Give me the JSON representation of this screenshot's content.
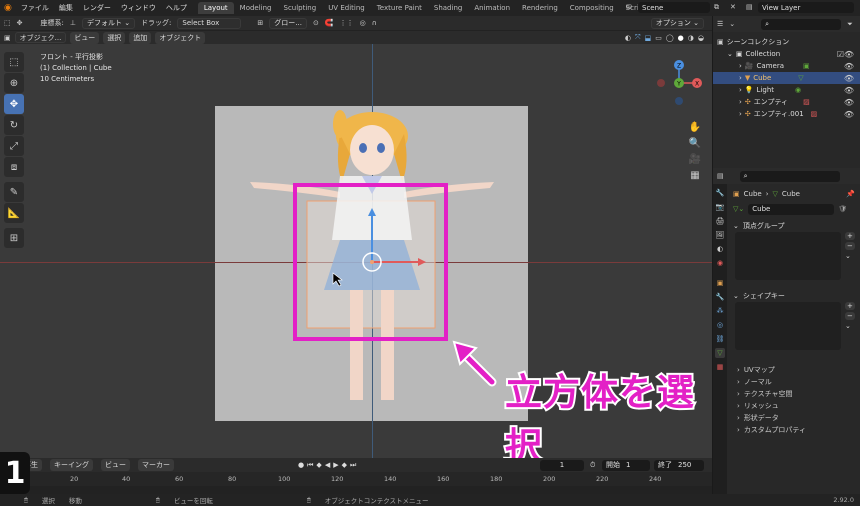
{
  "topbar": {
    "menus": [
      "ファイル",
      "編集",
      "レンダー",
      "ウィンドウ",
      "ヘルプ"
    ],
    "workspaces": [
      "Layout",
      "Modeling",
      "Sculpting",
      "UV Editing",
      "Texture Paint",
      "Shading",
      "Animation",
      "Rendering",
      "Compositing",
      "Scripting"
    ],
    "active_workspace": "Layout",
    "scene": "Scene",
    "view_layer": "View Layer"
  },
  "header2": {
    "coord_label": "座標系:",
    "coord_value": "デフォルト",
    "drag_label": "ドラッグ:",
    "drag_value": "Select Box",
    "pivot": "グロー...",
    "options": "オプション"
  },
  "header3": {
    "mode": "オブジェク...",
    "menus": [
      "ビュー",
      "選択",
      "追加",
      "オブジェクト"
    ]
  },
  "viewport": {
    "view_name": "フロント - 平行投影",
    "collection_info": "(1) Collection | Cube",
    "scale": "10 Centimeters",
    "gizmo": {
      "x": "X",
      "y": "Y",
      "z": "Z"
    },
    "annotation": "立方体を選択"
  },
  "timeline": {
    "menus": [
      "再生",
      "キーイング",
      "ビュー",
      "マーカー"
    ],
    "current_frame": "1",
    "start_label": "開始",
    "start": "1",
    "end_label": "終了",
    "end": "250",
    "ruler": [
      "20",
      "40",
      "60",
      "80",
      "100",
      "120",
      "140",
      "160",
      "180",
      "200",
      "220",
      "240"
    ]
  },
  "step_badge": "1",
  "statusbar": {
    "items": [
      "選択",
      "移動",
      "ビューを回転",
      "オブジェクトコンテクストメニュー"
    ],
    "version": "2.92.0"
  },
  "outliner": {
    "root": "シーンコレクション",
    "collection": "Collection",
    "items": [
      "Camera",
      "Cube",
      "Light",
      "エンプティ",
      "エンプティ.001"
    ],
    "selected": "Cube"
  },
  "properties": {
    "object_name": "Cube",
    "data_name": "Cube",
    "mesh_field": "Cube",
    "panels": [
      "頂点グループ",
      "シェイプキー"
    ],
    "subpanels": [
      "UVマップ",
      "ノーマル",
      "テクスチャ空間",
      "リメッシュ",
      "形状データ",
      "カスタムプロパティ"
    ]
  },
  "colors": {
    "accent": "#4772b3",
    "highlight": "#e320c6",
    "outliner_selected": "#334d80"
  }
}
